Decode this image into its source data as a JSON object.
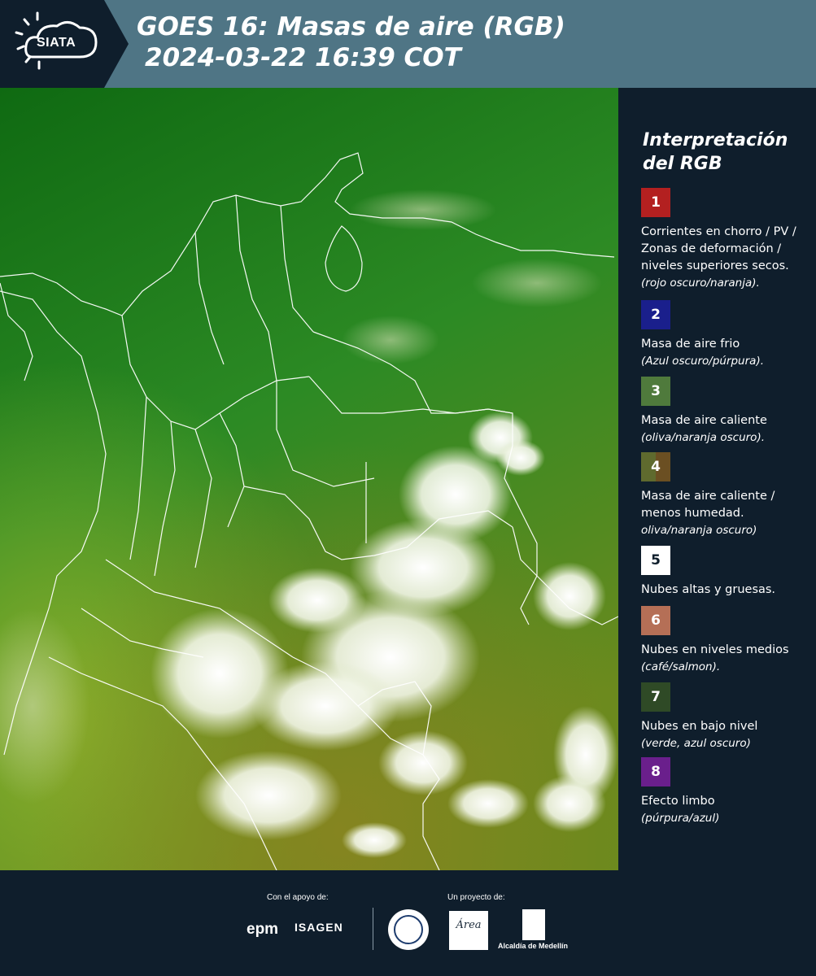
{
  "header": {
    "logo_text": "SIATA",
    "title_line1": "GOES 16: Masas de aire (RGB)",
    "title_line2": "2024-03-22 16:39 COT",
    "bg_color": "#4f7585"
  },
  "legend": {
    "title": "Interpretación del RGB",
    "items": [
      {
        "num": "1",
        "color": "#b32020",
        "label": "Corrientes en chorro / PV / Zonas de deformación / niveles superiores secos.",
        "note": "(rojo oscuro/naranja)."
      },
      {
        "num": "2",
        "color": "#1a1f8c",
        "label": "Masa de aire frio",
        "note": "(Azul oscuro/púrpura)."
      },
      {
        "num": "3",
        "color": "#4f7a3c",
        "label": "Masa de aire caliente",
        "note": "(oliva/naranja oscuro)."
      },
      {
        "num": "4",
        "color": "#6b4f22",
        "label": "Masa de aire caliente / menos humedad.",
        "note": "oliva/naranja oscuro)"
      },
      {
        "num": "5",
        "color": "#ffffff",
        "label": "Nubes altas y gruesas.",
        "note": ""
      },
      {
        "num": "6",
        "color": "#b56f56",
        "label": "Nubes en niveles medios",
        "note": "(café/salmon)."
      },
      {
        "num": "7",
        "color": "#2f4a26",
        "label": "Nubes en bajo nivel",
        "note": "(verde, azul oscuro)"
      },
      {
        "num": "8",
        "color": "#6a1f8c",
        "label": "Efecto limbo",
        "note": "(púrpura/azul)"
      }
    ]
  },
  "footer": {
    "support_label": "Con el apoyo de:",
    "project_label": "Un proyecto de:",
    "sponsors": [
      "epm",
      "ISAGEN"
    ],
    "area_logo_text": "Área",
    "alcaldia": "Alcaldía de Medellín"
  }
}
